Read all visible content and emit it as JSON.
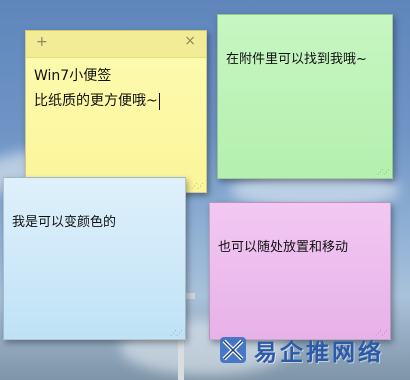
{
  "notes": {
    "yellow": {
      "add_label": "+",
      "close_label": "×",
      "line1": "Win7小便签",
      "line2": "比纸质的更方便哦~"
    },
    "green": {
      "text": "在附件里可以找到我哦~"
    },
    "blue": {
      "text": "我是可以变颜色的"
    },
    "pink": {
      "text": "也可以随处放置和移动"
    }
  },
  "watermark": {
    "text": "易企推网络"
  },
  "colors": {
    "yellow": "#fbf59a",
    "green": "#b4f0ae",
    "blue": "#bfe2f6",
    "pink": "#e7b2e9",
    "watermark": "#2b5aa8"
  }
}
